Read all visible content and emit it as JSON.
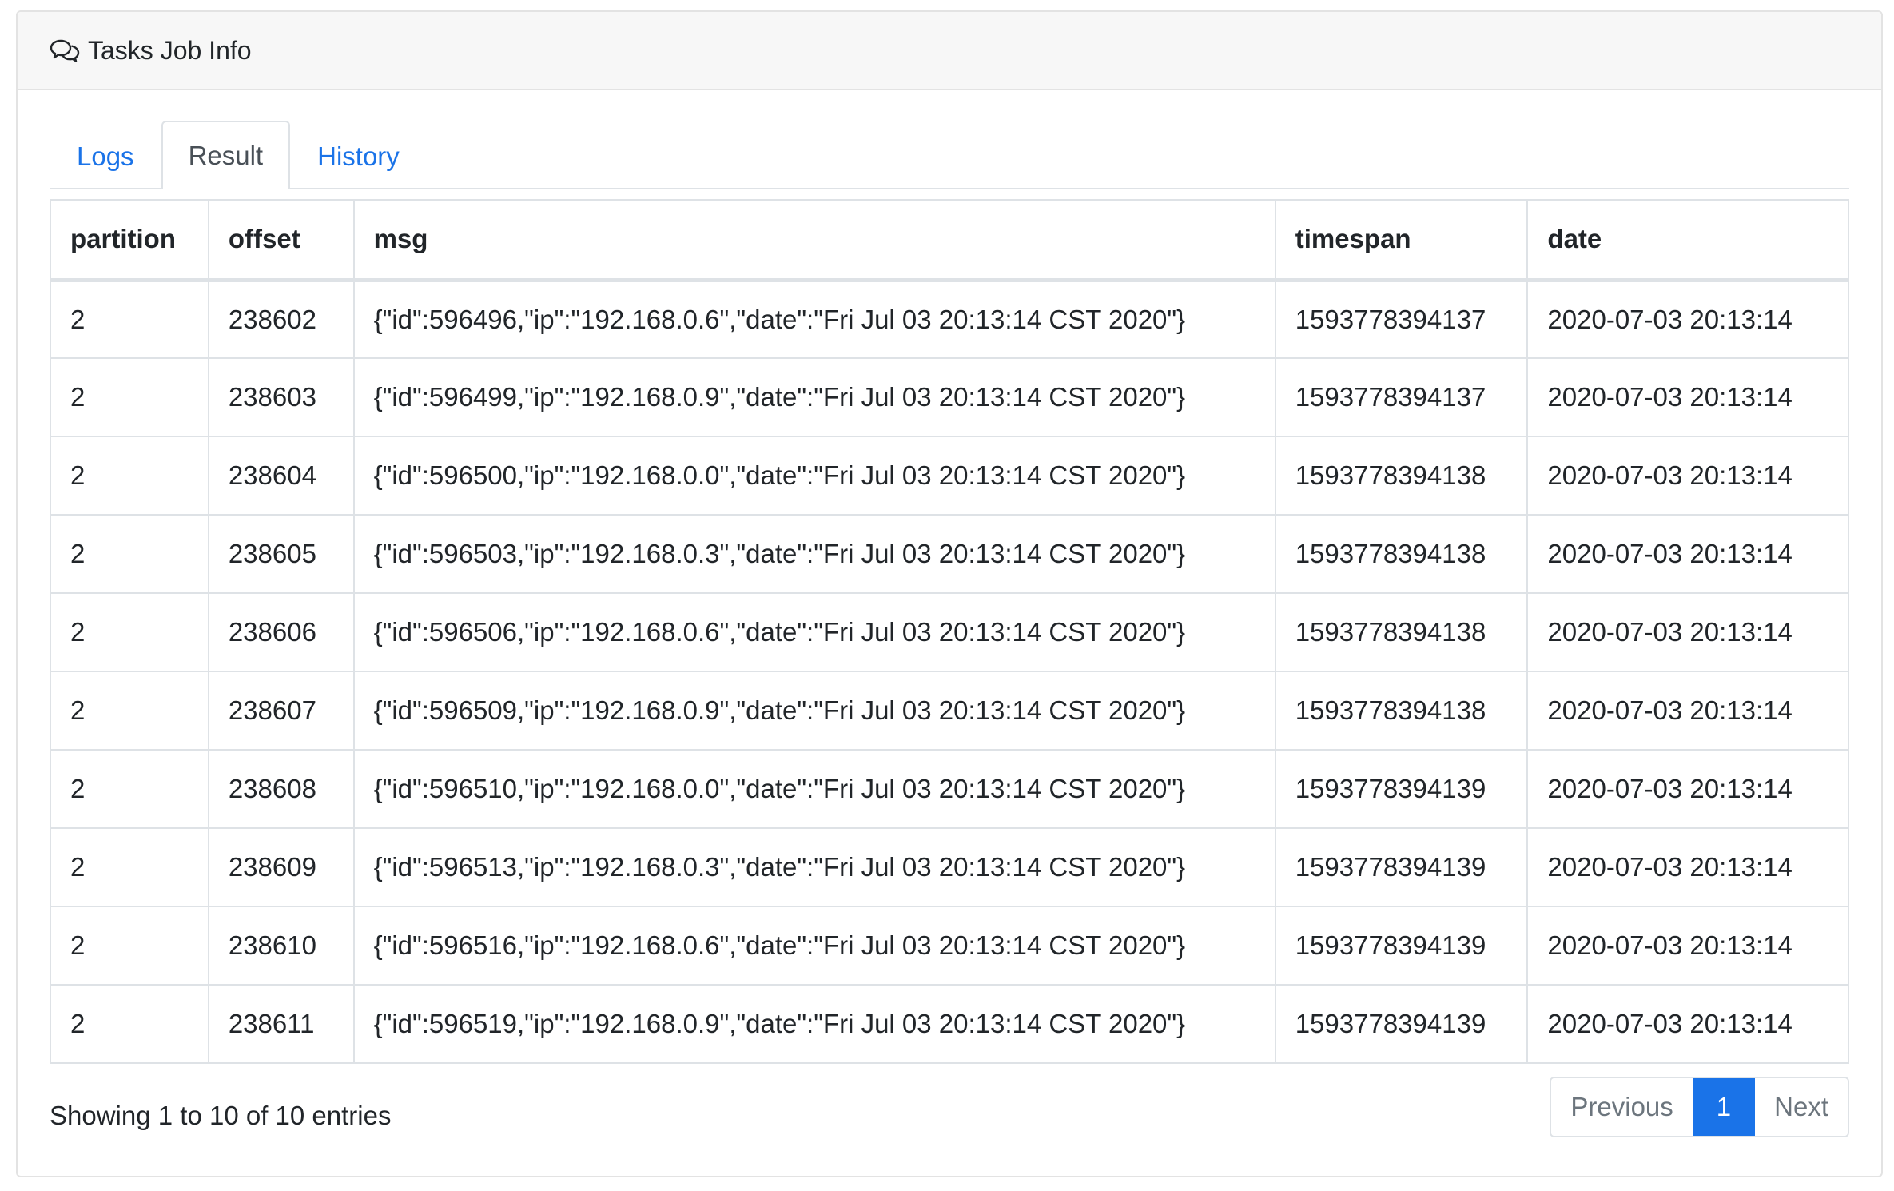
{
  "header": {
    "title": "Tasks Job Info",
    "icon": "comments-icon"
  },
  "tabs": [
    {
      "label": "Logs",
      "active": false
    },
    {
      "label": "Result",
      "active": true
    },
    {
      "label": "History",
      "active": false
    }
  ],
  "table": {
    "columns": [
      "partition",
      "offset",
      "msg",
      "timespan",
      "date"
    ],
    "rows": [
      [
        "2",
        "238602",
        "{\"id\":596496,\"ip\":\"192.168.0.6\",\"date\":\"Fri Jul 03 20:13:14 CST 2020\"}",
        "1593778394137",
        "2020-07-03 20:13:14"
      ],
      [
        "2",
        "238603",
        "{\"id\":596499,\"ip\":\"192.168.0.9\",\"date\":\"Fri Jul 03 20:13:14 CST 2020\"}",
        "1593778394137",
        "2020-07-03 20:13:14"
      ],
      [
        "2",
        "238604",
        "{\"id\":596500,\"ip\":\"192.168.0.0\",\"date\":\"Fri Jul 03 20:13:14 CST 2020\"}",
        "1593778394138",
        "2020-07-03 20:13:14"
      ],
      [
        "2",
        "238605",
        "{\"id\":596503,\"ip\":\"192.168.0.3\",\"date\":\"Fri Jul 03 20:13:14 CST 2020\"}",
        "1593778394138",
        "2020-07-03 20:13:14"
      ],
      [
        "2",
        "238606",
        "{\"id\":596506,\"ip\":\"192.168.0.6\",\"date\":\"Fri Jul 03 20:13:14 CST 2020\"}",
        "1593778394138",
        "2020-07-03 20:13:14"
      ],
      [
        "2",
        "238607",
        "{\"id\":596509,\"ip\":\"192.168.0.9\",\"date\":\"Fri Jul 03 20:13:14 CST 2020\"}",
        "1593778394138",
        "2020-07-03 20:13:14"
      ],
      [
        "2",
        "238608",
        "{\"id\":596510,\"ip\":\"192.168.0.0\",\"date\":\"Fri Jul 03 20:13:14 CST 2020\"}",
        "1593778394139",
        "2020-07-03 20:13:14"
      ],
      [
        "2",
        "238609",
        "{\"id\":596513,\"ip\":\"192.168.0.3\",\"date\":\"Fri Jul 03 20:13:14 CST 2020\"}",
        "1593778394139",
        "2020-07-03 20:13:14"
      ],
      [
        "2",
        "238610",
        "{\"id\":596516,\"ip\":\"192.168.0.6\",\"date\":\"Fri Jul 03 20:13:14 CST 2020\"}",
        "1593778394139",
        "2020-07-03 20:13:14"
      ],
      [
        "2",
        "238611",
        "{\"id\":596519,\"ip\":\"192.168.0.9\",\"date\":\"Fri Jul 03 20:13:14 CST 2020\"}",
        "1593778394139",
        "2020-07-03 20:13:14"
      ]
    ]
  },
  "footer": {
    "info": "Showing 1 to 10 of 10 entries",
    "pagination": {
      "previous": "Previous",
      "current": "1",
      "next": "Next"
    }
  },
  "colors": {
    "accent": "#1a73e8",
    "border": "#dee2e6",
    "header_bg": "#f7f7f7"
  }
}
